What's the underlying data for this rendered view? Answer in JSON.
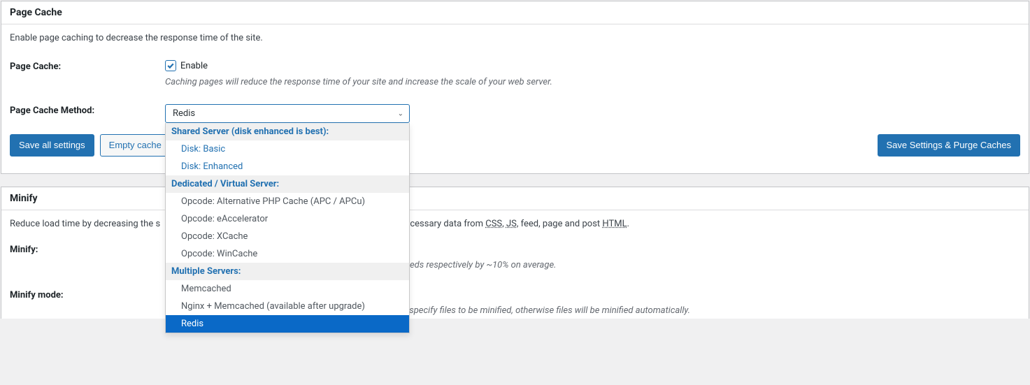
{
  "sections": {
    "page_cache": {
      "title": "Page Cache",
      "intro": "Enable page caching to decrease the response time of the site.",
      "fields": {
        "enable": {
          "label": "Page Cache:",
          "checkbox_label": "Enable",
          "checked": true,
          "description": "Caching pages will reduce the response time of your site and increase the scale of your web server."
        },
        "method": {
          "label": "Page Cache Method:",
          "selected": "Redis",
          "groups": [
            {
              "label": "Shared Server (disk enhanced is best):",
              "style": "link",
              "options": [
                "Disk: Basic",
                "Disk: Enhanced"
              ]
            },
            {
              "label": "Dedicated / Virtual Server:",
              "style": "plain",
              "options": [
                "Opcode: Alternative PHP Cache (APC / APCu)",
                "Opcode: eAccelerator",
                "Opcode: XCache",
                "Opcode: WinCache"
              ]
            },
            {
              "label": "Multiple Servers:",
              "style": "plain",
              "options": [
                "Memcached",
                "Nginx + Memcached (available after upgrade)",
                "Redis"
              ]
            }
          ]
        }
      },
      "buttons": {
        "save_all": "Save all settings",
        "empty_cache": "Empty cache",
        "save_purge": "Save Settings & Purge Caches"
      }
    },
    "minify": {
      "title": "Minify",
      "intro_pre": "Reduce load time by decreasing the s",
      "intro_post": "ncessary data from ",
      "intro_css": "CSS",
      "intro_sep1": ", ",
      "intro_js": "JS",
      "intro_sep2": ", feed, page and post ",
      "intro_html": "HTML",
      "intro_end": ".",
      "minify_label": "Minify:",
      "minify_partial": "eds respectively by ~10% on average.",
      "mode_label": "Minify mode:",
      "mode_description": "Select manual mode to use fields on the minify settings tab to specify files to be minified, otherwise files will be minified automatically."
    }
  }
}
